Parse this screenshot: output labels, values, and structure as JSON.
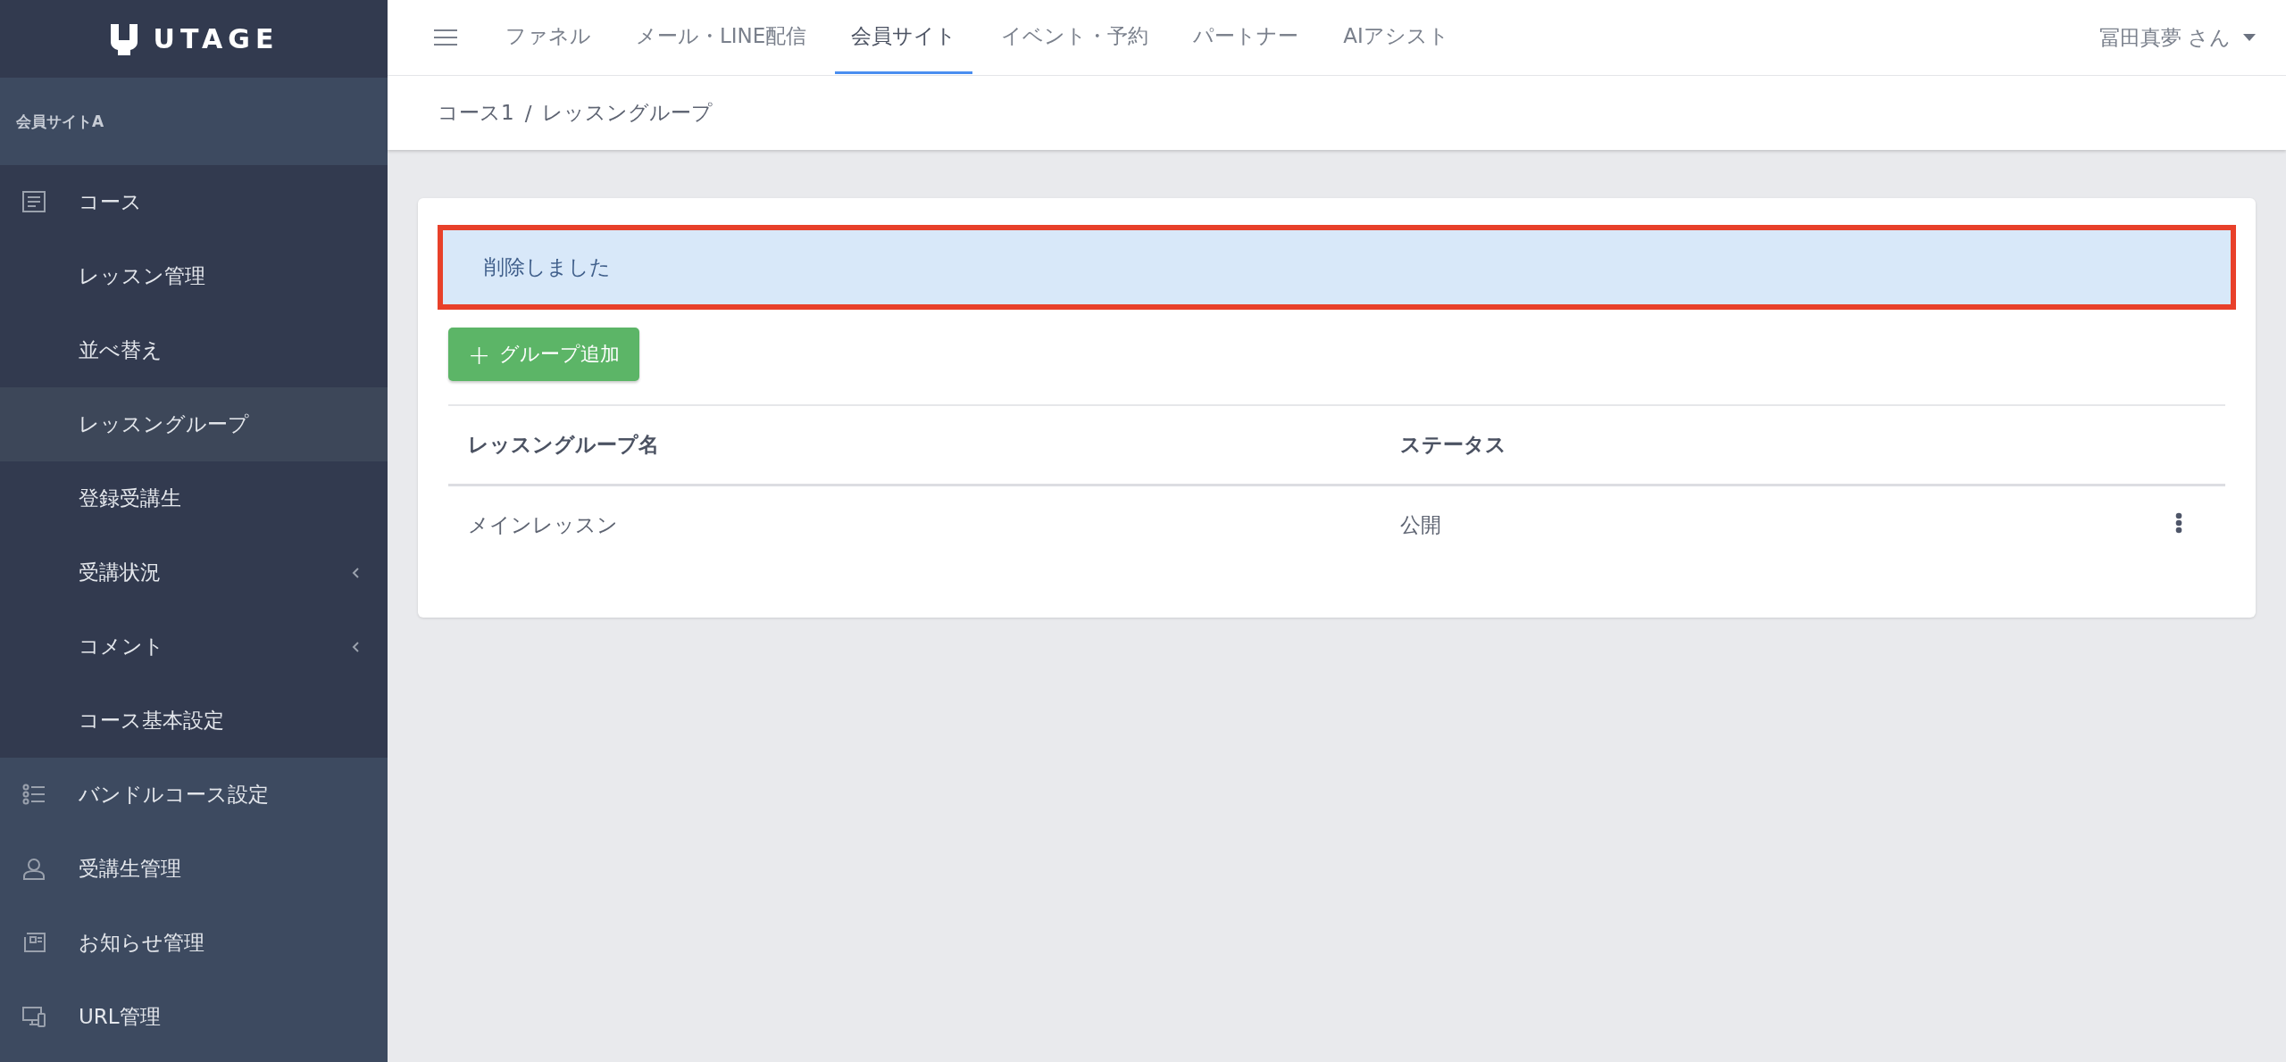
{
  "logo": {
    "text": "UTAGE"
  },
  "sidebar": {
    "section_title": "会員サイトA",
    "items": [
      {
        "label": "コース",
        "expanded": true,
        "children": [
          {
            "label": "レッスン管理",
            "selected": false,
            "has_submenu": false
          },
          {
            "label": "並べ替え",
            "selected": false,
            "has_submenu": false
          },
          {
            "label": "レッスングループ",
            "selected": true,
            "has_submenu": false
          },
          {
            "label": "登録受講生",
            "selected": false,
            "has_submenu": false
          },
          {
            "label": "受講状況",
            "selected": false,
            "has_submenu": true
          },
          {
            "label": "コメント",
            "selected": false,
            "has_submenu": true
          },
          {
            "label": "コース基本設定",
            "selected": false,
            "has_submenu": false
          }
        ]
      },
      {
        "label": "バンドルコース設定",
        "expanded": false
      },
      {
        "label": "受講生管理",
        "expanded": false
      },
      {
        "label": "お知らせ管理",
        "expanded": false
      },
      {
        "label": "URL管理",
        "expanded": false
      }
    ]
  },
  "tabs": [
    {
      "label": "ファネル",
      "selected": false
    },
    {
      "label": "メール・LINE配信",
      "selected": false
    },
    {
      "label": "会員サイト",
      "selected": true
    },
    {
      "label": "イベント・予約",
      "selected": false
    },
    {
      "label": "パートナー",
      "selected": false
    },
    {
      "label": "AIアシスト",
      "selected": false
    }
  ],
  "user": {
    "name": "冨田真夢 さん"
  },
  "breadcrumb": [
    "コース1",
    "/",
    "レッスングループ"
  ],
  "alert": {
    "message": "削除しました",
    "highlighted": true
  },
  "add_button": {
    "icon": "+",
    "label": "グループ追加"
  },
  "table": {
    "columns": [
      "レッスングループ名",
      "ステータス"
    ],
    "rows": [
      {
        "cells": [
          "メインレッスン",
          "公開"
        ]
      }
    ]
  }
}
